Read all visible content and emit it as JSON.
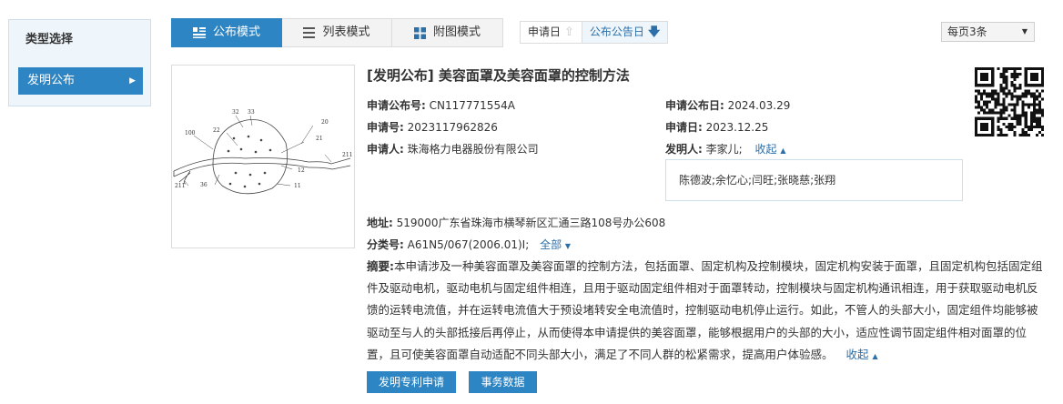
{
  "sidebar": {
    "title": "类型选择",
    "items": [
      {
        "label": "发明公布"
      }
    ]
  },
  "view_tabs": [
    {
      "label": "公布模式",
      "icon": "card-view-icon",
      "active": true
    },
    {
      "label": "列表模式",
      "icon": "list-view-icon",
      "active": false
    },
    {
      "label": "附图模式",
      "icon": "grid-view-icon",
      "active": false
    }
  ],
  "sort": {
    "by_application_date": "申请日",
    "by_publication_date": "公布公告日"
  },
  "page_size": {
    "selected": "每页3条"
  },
  "record": {
    "title": "[发明公布] 美容面罩及美容面罩的控制方法",
    "pub_no_label": "申请公布号:",
    "pub_no": "CN117771554A",
    "pub_date_label": "申请公布日:",
    "pub_date": "2024.03.29",
    "app_no_label": "申请号:",
    "app_no": "2023117962826",
    "app_date_label": "申请日:",
    "app_date": "2023.12.25",
    "applicant_label": "申请人:",
    "applicant": "珠海格力电器股份有限公司",
    "inventor_label": "发明人:",
    "inventor": "李家儿;",
    "collapse_label": "收起",
    "more_inventors": "陈德波;余忆心;闫旺;张晓慈;张翔",
    "address_label": "地址:",
    "address": "519000广东省珠海市横琴新区汇通三路108号办公608",
    "class_label": "分类号:",
    "class_no": "A61N5/067(2006.01)I;",
    "all_label": "全部",
    "abstract_label": "摘要:",
    "abstract": "本申请涉及一种美容面罩及美容面罩的控制方法，包括面罩、固定机构及控制模块，固定机构安装于面罩，且固定机构包括固定组件及驱动电机，驱动电机与固定组件相连，且用于驱动固定组件相对于面罩转动，控制模块与固定机构通讯相连，用于获取驱动电机反馈的运转电流值，并在运转电流值大于预设堵转安全电流值时，控制驱动电机停止运行。如此，不管人的头部大小，固定组件均能够被驱动至与人的头部抵接后再停止，从而使得本申请提供的美容面罩，能够根据用户的头部的大小，适应性调节固定组件相对面罩的位置，且可使美容面罩自动适配不同头部大小，满足了不同人群的松紧需求，提高用户体验感。",
    "abstract_collapse": "收起",
    "drawing_labels": [
      "32",
      "33",
      "20",
      "22",
      "21",
      "100",
      "12",
      "211",
      "211",
      "36",
      "11"
    ]
  },
  "buttons": {
    "apply": "发明专利申请",
    "affairs": "事务数据"
  },
  "colors": {
    "primary": "#2d85c4",
    "link": "#2d6fa8"
  }
}
